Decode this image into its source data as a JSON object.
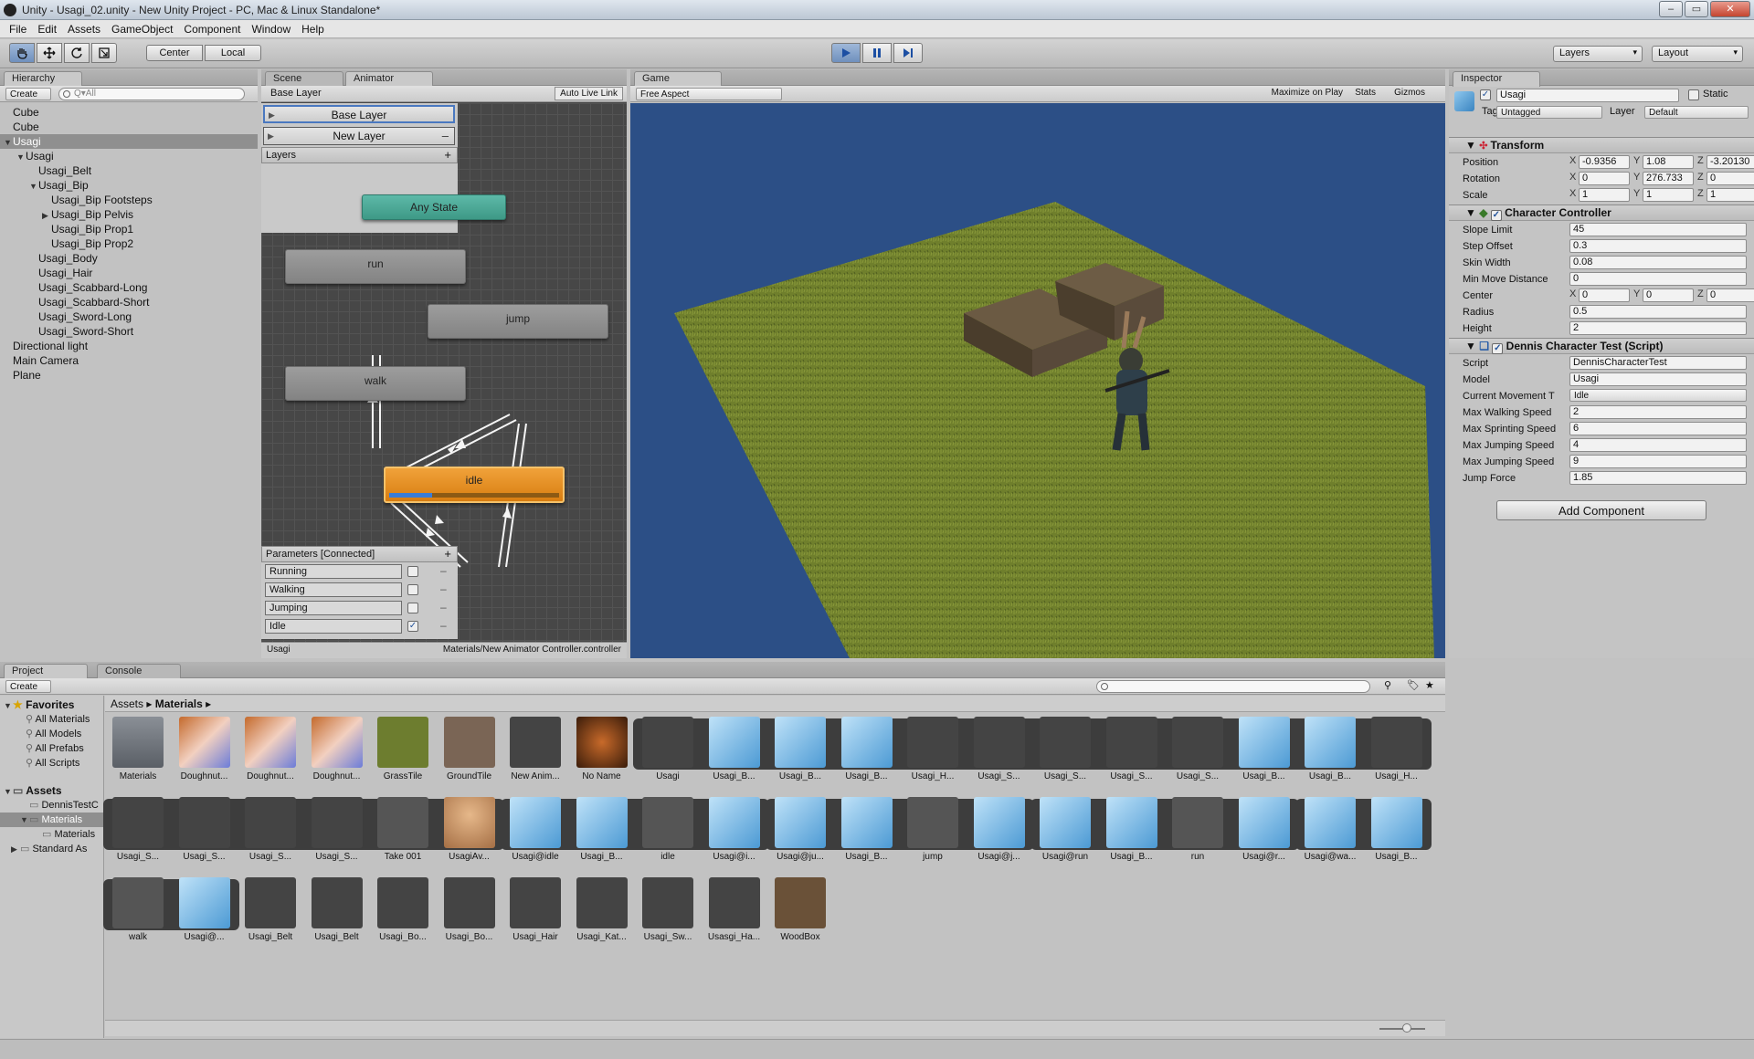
{
  "title": "Unity - Usagi_02.unity - New Unity Project - PC, Mac & Linux Standalone*",
  "window_buttons": {
    "min": "–",
    "max": "▭",
    "close": "✕"
  },
  "menu": [
    "File",
    "Edit",
    "Assets",
    "GameObject",
    "Component",
    "Window",
    "Help"
  ],
  "toolbar": {
    "center": "Center",
    "local": "Local",
    "layers": "Layers",
    "layout": "Layout"
  },
  "hierarchy": {
    "tab": "Hierarchy",
    "create": "Create",
    "search_placeholder": "Q▾All",
    "items": [
      {
        "label": "Cube",
        "indent": 0,
        "arrow": ""
      },
      {
        "label": "Cube",
        "indent": 0,
        "arrow": ""
      },
      {
        "label": "Usagi",
        "indent": 0,
        "arrow": "▼",
        "selected": true
      },
      {
        "label": "Usagi",
        "indent": 1,
        "arrow": "▼"
      },
      {
        "label": "Usagi_Belt",
        "indent": 2,
        "arrow": ""
      },
      {
        "label": "Usagi_Bip",
        "indent": 2,
        "arrow": "▼"
      },
      {
        "label": "Usagi_Bip Footsteps",
        "indent": 3,
        "arrow": ""
      },
      {
        "label": "Usagi_Bip Pelvis",
        "indent": 3,
        "arrow": "▶"
      },
      {
        "label": "Usagi_Bip Prop1",
        "indent": 3,
        "arrow": ""
      },
      {
        "label": "Usagi_Bip Prop2",
        "indent": 3,
        "arrow": ""
      },
      {
        "label": "Usagi_Body",
        "indent": 2,
        "arrow": ""
      },
      {
        "label": "Usagi_Hair",
        "indent": 2,
        "arrow": ""
      },
      {
        "label": "Usagi_Scabbard-Long",
        "indent": 2,
        "arrow": ""
      },
      {
        "label": "Usagi_Scabbard-Short",
        "indent": 2,
        "arrow": ""
      },
      {
        "label": "Usagi_Sword-Long",
        "indent": 2,
        "arrow": ""
      },
      {
        "label": "Usagi_Sword-Short",
        "indent": 2,
        "arrow": ""
      },
      {
        "label": "Directional light",
        "indent": 0,
        "arrow": ""
      },
      {
        "label": "Main Camera",
        "indent": 0,
        "arrow": ""
      },
      {
        "label": "Plane",
        "indent": 0,
        "arrow": ""
      }
    ]
  },
  "animator": {
    "tabs": [
      "Scene",
      "Animator"
    ],
    "base_layer": "Base Layer",
    "auto_live_link": "Auto Live Link",
    "layers": [
      {
        "label": "Base Layer",
        "op": ""
      },
      {
        "label": "New Layer",
        "op": "–"
      }
    ],
    "layers_header": "Layers",
    "plus": "+",
    "states": {
      "any": "Any State",
      "run": "run",
      "jump": "jump",
      "walk": "walk",
      "idle": "idle"
    },
    "idle_progress": 0.25,
    "params_header": "Parameters [Connected]",
    "params": [
      {
        "name": "Running",
        "checked": false
      },
      {
        "name": "Walking",
        "checked": false
      },
      {
        "name": "Jumping",
        "checked": false
      },
      {
        "name": "Idle",
        "checked": true
      }
    ],
    "footer_left": "Usagi",
    "footer_right": "Materials/New Animator Controller.controller"
  },
  "game": {
    "tab": "Game",
    "aspect": "Free Aspect",
    "maximize": "Maximize on Play",
    "stats": "Stats",
    "gizmos": "Gizmos"
  },
  "inspector": {
    "tab": "Inspector",
    "name": "Usagi",
    "static": "Static",
    "tag_label": "Tag",
    "tag": "Untagged",
    "layer_label": "Layer",
    "layer": "Default",
    "transform": {
      "title": "Transform",
      "position": [
        "-0.9356",
        "1.08",
        "-3.20130"
      ],
      "rotation": [
        "0",
        "276.733",
        "0"
      ],
      "scale": [
        "1",
        "1",
        "1"
      ],
      "labels": [
        "Position",
        "Rotation",
        "Scale"
      ]
    },
    "cc": {
      "title": "Character Controller",
      "fields": [
        {
          "label": "Slope Limit",
          "value": "45"
        },
        {
          "label": "Step Offset",
          "value": "0.3"
        },
        {
          "label": "Skin Width",
          "value": "0.08"
        },
        {
          "label": "Min Move Distance",
          "value": "0"
        }
      ],
      "center_label": "Center",
      "center": [
        "0",
        "0",
        "0"
      ],
      "radius_label": "Radius",
      "radius": "0.5",
      "height_label": "Height",
      "height": "2"
    },
    "script": {
      "title": "Dennis Character Test (Script)",
      "fields": [
        {
          "label": "Script",
          "value": "DennisCharacterTest"
        },
        {
          "label": "Model",
          "value": "Usagi"
        },
        {
          "label": "Current Movement T",
          "value": "Idle"
        },
        {
          "label": "Max Walking Speed",
          "value": "2"
        },
        {
          "label": "Max Sprinting Speed",
          "value": "6"
        },
        {
          "label": "Max Jumping Speed",
          "value": "4"
        },
        {
          "label": "Max Jumping Speed",
          "value": "9"
        },
        {
          "label": "Jump Force",
          "value": "1.85"
        }
      ]
    },
    "add_component": "Add Component",
    "axes": [
      "X",
      "Y",
      "Z"
    ]
  },
  "project": {
    "tabs": [
      "Project",
      "Console"
    ],
    "create": "Create",
    "favorites_header": "Favorites",
    "favorites": [
      "All Materials",
      "All Models",
      "All Prefabs",
      "All Scripts"
    ],
    "assets_header": "Assets",
    "assets_tree": [
      "DennisTestC",
      "Materials",
      "Materials",
      "Standard As"
    ],
    "breadcrumb": [
      "Assets",
      "Materials"
    ],
    "row1": [
      "Materials",
      "Doughnut...",
      "Doughnut...",
      "Doughnut...",
      "GrassTile",
      "GroundTile",
      "New Anim...",
      "No Name",
      "Usagi",
      "Usagi_B...",
      "Usagi_B...",
      "Usagi_B...",
      "Usagi_H...",
      "Usagi_S...",
      "Usagi_S...",
      "Usagi_S...",
      "Usagi_S...",
      "Usagi_B...",
      "Usagi_B...",
      "Usagi_H..."
    ],
    "row2": [
      "Usagi_S...",
      "Usagi_S...",
      "Usagi_S...",
      "Usagi_S...",
      "Take 001",
      "UsagiAv...",
      "Usagi@idle",
      "Usagi_B...",
      "idle",
      "Usagi@i...",
      "Usagi@ju...",
      "Usagi_B...",
      "jump",
      "Usagi@j...",
      "Usagi@run",
      "Usagi_B...",
      "run",
      "Usagi@r...",
      "Usagi@wa...",
      "Usagi_B..."
    ],
    "row3": [
      "walk",
      "Usagi@...",
      "Usagi_Belt",
      "Usagi_Belt",
      "Usagi_Bo...",
      "Usagi_Bo...",
      "Usagi_Hair",
      "Usagi_Kat...",
      "Usagi_Sw...",
      "Usasgi_Ha...",
      "WoodBox"
    ]
  },
  "colors": {
    "accent": "#3f7fc7",
    "idle_state": "#e08a1c",
    "any_state": "#4aa795",
    "scene_sky": "#2c4f86",
    "grass": "#6f7f2c"
  }
}
